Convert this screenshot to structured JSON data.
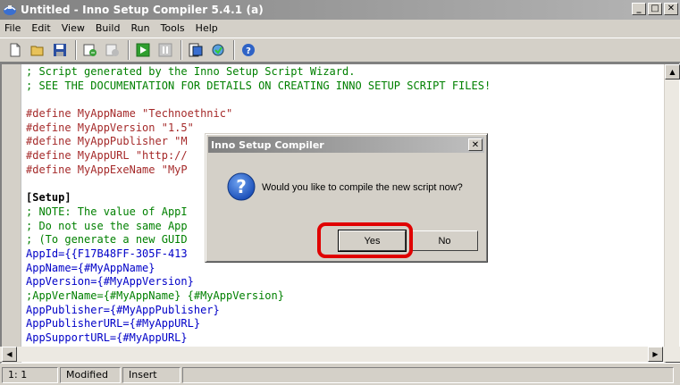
{
  "window": {
    "title": "Untitled - Inno Setup Compiler 5.4.1 (a)",
    "minimize": "_",
    "maximize": "□",
    "close": "✕"
  },
  "menu": [
    "File",
    "Edit",
    "View",
    "Build",
    "Run",
    "Tools",
    "Help"
  ],
  "toolbar": {
    "icons": [
      "new-file-icon",
      "open-folder-icon",
      "save-icon",
      "compile-icon",
      "stop-compile-icon",
      "run-icon",
      "pause-icon",
      "target-setup-icon",
      "uninstall-icon",
      "help-icon"
    ]
  },
  "editor": {
    "lines": [
      {
        "cls": "c-comment",
        "text": "; Script generated by the Inno Setup Script Wizard."
      },
      {
        "cls": "c-comment",
        "text": "; SEE THE DOCUMENTATION FOR DETAILS ON CREATING INNO SETUP SCRIPT FILES!"
      },
      {
        "cls": "c-blank",
        "text": ""
      },
      {
        "cls": "c-define",
        "text": "#define MyAppName \"Technoethnic\""
      },
      {
        "cls": "c-define",
        "text": "#define MyAppVersion \"1.5\""
      },
      {
        "cls": "c-define",
        "text": "#define MyAppPublisher \"M"
      },
      {
        "cls": "c-define",
        "text": "#define MyAppURL \"http://"
      },
      {
        "cls": "c-define",
        "text": "#define MyAppExeName \"MyP"
      },
      {
        "cls": "c-blank",
        "text": ""
      },
      {
        "cls": "c-section",
        "text": "[Setup]"
      },
      {
        "cls": "c-comment",
        "text": "; NOTE: The value of AppI"
      },
      {
        "cls": "c-comment",
        "text": "; Do not use the same App                                    ations."
      },
      {
        "cls": "c-comment",
        "text": "; (To generate a new GUID                                    IDE.)"
      },
      {
        "cls": "c-key",
        "text": "AppId={{F17B48FF-305F-413"
      },
      {
        "cls": "c-key",
        "text": "AppName={#MyAppName}"
      },
      {
        "cls": "c-key",
        "text": "AppVersion={#MyAppVersion}"
      },
      {
        "cls": "c-comment",
        "text": ";AppVerName={#MyAppName} {#MyAppVersion}"
      },
      {
        "cls": "c-key",
        "text": "AppPublisher={#MyAppPublisher}"
      },
      {
        "cls": "c-key",
        "text": "AppPublisherURL={#MyAppURL}"
      },
      {
        "cls": "c-key",
        "text": "AppSupportURL={#MyAppURL}"
      }
    ]
  },
  "status": {
    "position": "1:   1",
    "modified": "Modified",
    "mode": "Insert"
  },
  "dialog": {
    "title": "Inno Setup Compiler",
    "close": "✕",
    "message": "Would you like to compile the new script now?",
    "yes_label": "Yes",
    "no_label": "No",
    "highlight_color": "#e00000"
  }
}
